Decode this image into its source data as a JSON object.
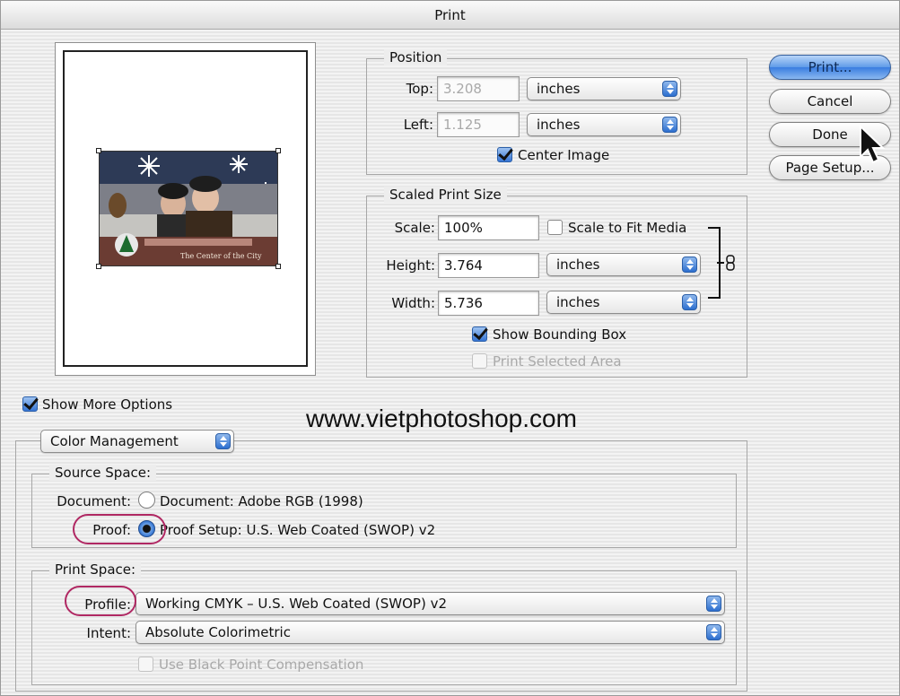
{
  "window": {
    "title": "Print"
  },
  "buttons": {
    "print": "Print...",
    "cancel": "Cancel",
    "done": "Done",
    "page_setup": "Page Setup..."
  },
  "position": {
    "legend": "Position",
    "top_label": "Top:",
    "top_value": "3.208",
    "top_units": "inches",
    "left_label": "Left:",
    "left_value": "1.125",
    "left_units": "inches",
    "center_image_label": "Center Image",
    "center_image_checked": true
  },
  "scaled": {
    "legend": "Scaled Print Size",
    "scale_label": "Scale:",
    "scale_value": "100%",
    "scale_to_fit_label": "Scale to Fit Media",
    "scale_to_fit_checked": false,
    "height_label": "Height:",
    "height_value": "3.764",
    "height_units": "inches",
    "width_label": "Width:",
    "width_value": "5.736",
    "width_units": "inches",
    "show_bbox_label": "Show Bounding Box",
    "show_bbox_checked": true,
    "print_selected_label": "Print Selected Area",
    "print_selected_checked": false
  },
  "preview": {
    "caption": "The Center of the City"
  },
  "more_options": {
    "label": "Show More Options",
    "checked": true,
    "mode": "Color Management"
  },
  "watermark": "www.vietphotoshop.com",
  "source_space": {
    "legend": "Source Space:",
    "document_label": "Document:",
    "document_option": "Document:  Adobe RGB (1998)",
    "proof_label": "Proof:",
    "proof_option": "Proof Setup:  U.S. Web Coated (SWOP) v2",
    "selected": "proof"
  },
  "print_space": {
    "legend": "Print Space:",
    "profile_label": "Profile:",
    "profile_value": "Working CMYK – U.S. Web Coated (SWOP) v2",
    "intent_label": "Intent:",
    "intent_value": "Absolute Colorimetric",
    "bpc_label": "Use Black Point Compensation",
    "bpc_checked": false
  },
  "colors": {
    "accent": "#3a7de0",
    "highlight_ring": "#b02863"
  }
}
